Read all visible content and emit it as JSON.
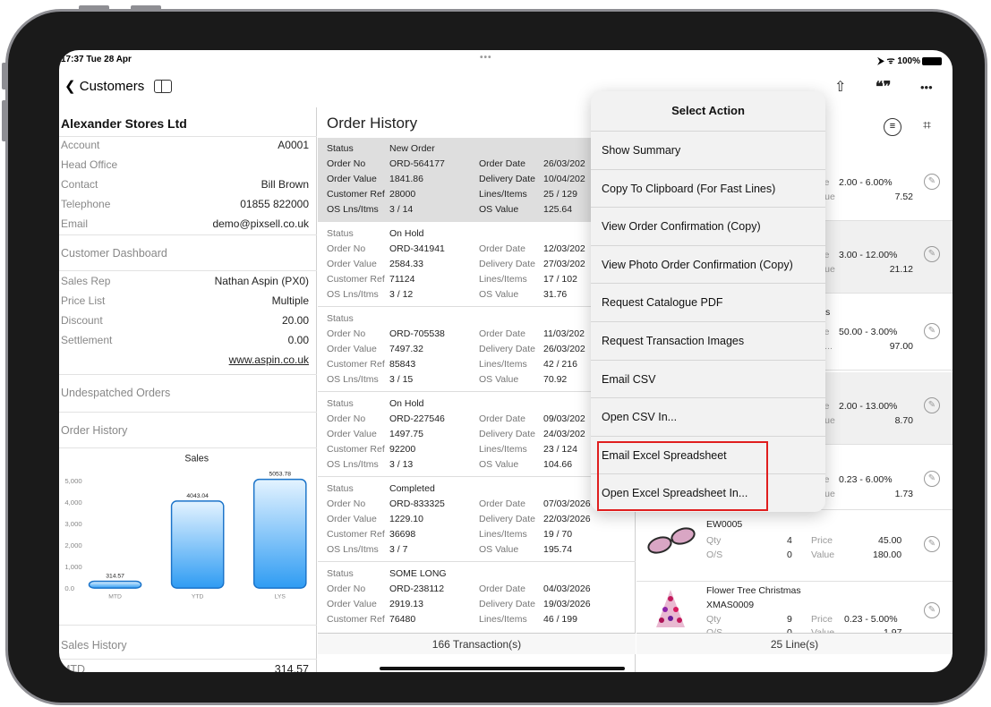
{
  "status": {
    "time": "17:37  Tue 28 Apr",
    "dots": "•••",
    "signal": "⮞ ᯤ 100%"
  },
  "nav": {
    "back_label": "Customers",
    "share_icon": "⇧",
    "quote_icon": "❝❞",
    "more_icon": "•••"
  },
  "customer": {
    "name": "Alexander Stores Ltd",
    "fields": [
      {
        "label": "Account",
        "value": "A0001"
      },
      {
        "label": "Head Office",
        "value": ""
      },
      {
        "label": "Contact",
        "value": "Bill Brown"
      },
      {
        "label": "Telephone",
        "value": "01855 822000"
      },
      {
        "label": "Email",
        "value": "demo@pixsell.co.uk"
      }
    ],
    "dashboard": "Customer Dashboard",
    "fields2": [
      {
        "label": "Sales Rep",
        "value": "Nathan Aspin (PX0)"
      },
      {
        "label": "Price List",
        "value": "Multiple"
      },
      {
        "label": "Discount",
        "value": "20.00"
      },
      {
        "label": "Settlement",
        "value": "0.00"
      }
    ],
    "website": "www.aspin.co.uk",
    "undespatched": "Undespatched Orders",
    "order_history": "Order History",
    "sales_history": "Sales History",
    "mtd_label": "MTD",
    "mtd_value": "314.57"
  },
  "chart_data": {
    "type": "bar",
    "title": "Sales",
    "categories": [
      "MTD",
      "YTD",
      "LYS"
    ],
    "values": [
      314.57,
      4043.04,
      5053.78
    ],
    "data_labels": [
      "314.57",
      "4043.04",
      "5053.78"
    ],
    "ylim": [
      0,
      5000
    ],
    "yticks": [
      "0.0",
      "1,000",
      "2,000",
      "3,000",
      "4,000",
      "5,000"
    ],
    "colors": {
      "top": "#e4f3ff",
      "bottom": "#2f9cf3",
      "edge": "#1a73c9"
    }
  },
  "orders": {
    "title": "Order History",
    "labels": {
      "status": "Status",
      "order_no": "Order No",
      "order_value": "Order Value",
      "cust_ref": "Customer Ref",
      "os_lns": "OS Lns/Itms",
      "order_date": "Order Date",
      "delivery_date": "Delivery Date",
      "lines_items": "Lines/Items",
      "os_value": "OS Value"
    },
    "items": [
      {
        "status": "New Order",
        "no": "ORD-564177",
        "value": "1841.86",
        "ref": "28000",
        "os": "3 / 14",
        "date": "26/03/202",
        "delivery": "10/04/202",
        "lines": "25 / 129",
        "osv": "125.64"
      },
      {
        "status": "On Hold",
        "no": "ORD-341941",
        "value": "2584.33",
        "ref": "71124",
        "os": "3 / 12",
        "date": "12/03/202",
        "delivery": "27/03/202",
        "lines": "17 / 102",
        "osv": "31.76"
      },
      {
        "status": "",
        "no": "ORD-705538",
        "value": "7497.32",
        "ref": "85843",
        "os": "3 / 15",
        "date": "11/03/202",
        "delivery": "26/03/202",
        "lines": "42 / 216",
        "osv": "70.92"
      },
      {
        "status": "On Hold",
        "no": "ORD-227546",
        "value": "1497.75",
        "ref": "92200",
        "os": "3 / 13",
        "date": "09/03/202",
        "delivery": "24/03/202",
        "lines": "23 / 124",
        "osv": "104.66"
      },
      {
        "status": "Completed",
        "no": "ORD-833325",
        "value": "1229.10",
        "ref": "36698",
        "os": "3 / 7",
        "date": "07/03/2026",
        "delivery": "22/03/2026",
        "lines": "19 / 70",
        "osv": "195.74"
      },
      {
        "status": "SOME LONG",
        "no": "ORD-238112",
        "value": "2919.13",
        "ref": "76480",
        "os": "",
        "date": "04/03/2026",
        "delivery": "19/03/2026",
        "lines": "46 / 199",
        "osv": ""
      }
    ],
    "footer": "166 Transaction(s)"
  },
  "lines": {
    "labels": {
      "price": "Price",
      "value": "Value",
      "qty": "Qty",
      "os": "O/S"
    },
    "items": [
      {
        "price_frag": "ice",
        "price": "2.00 - 6.00%",
        "val_frag": "alue",
        "value": "7.52",
        "partial": ""
      },
      {
        "price_frag": "ice",
        "price": "3.00 - 12.00%",
        "val_frag": "alue",
        "value": "21.12",
        "partial": ""
      },
      {
        "price_frag": "ice",
        "price": "50.00 - 3.00%",
        "val_frag": "al...",
        "value": "97.00",
        "partial": "s"
      },
      {
        "price_frag": "ice",
        "price": "2.00 - 13.00%",
        "val_frag": "alue",
        "value": "8.70",
        "partial": ""
      },
      {
        "price_frag": "ice",
        "price": "0.23 - 6.00%",
        "val_frag": "alue",
        "value": "1.73",
        "partial": ""
      }
    ],
    "eyewear": {
      "code": "EW0005",
      "qty": "4",
      "os": "0",
      "price": "45.00",
      "value": "180.00"
    },
    "tree": {
      "name": "Flower Tree Christmas",
      "code": "XMAS0009",
      "qty": "9",
      "os": "0",
      "price": "0.23 - 5.00%",
      "value": "1.97"
    },
    "footer": "25 Line(s)"
  },
  "popover": {
    "title": "Select Action",
    "items": [
      "Show Summary",
      "Copy To Clipboard (For Fast Lines)",
      "View Order Confirmation (Copy)",
      "View Photo Order Confirmation (Copy)",
      "Request Catalogue PDF",
      "Request Transaction Images",
      "Email CSV",
      "Open CSV In...",
      "Email Excel Spreadsheet",
      "Open Excel Spreadsheet In..."
    ]
  }
}
